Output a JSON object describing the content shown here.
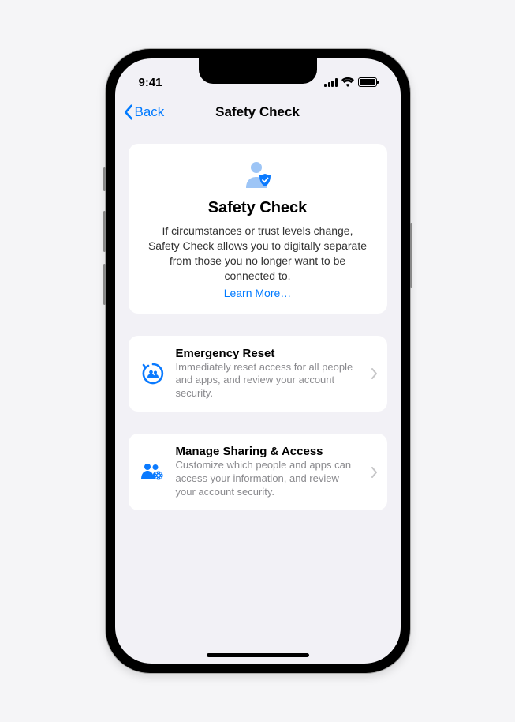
{
  "statusBar": {
    "time": "9:41"
  },
  "nav": {
    "back": "Back",
    "title": "Safety Check"
  },
  "hero": {
    "title": "Safety Check",
    "description": "If circumstances or trust levels change, Safety Check allows you to digitally separate from those you no longer want to be connected to.",
    "learnMore": "Learn More…"
  },
  "options": [
    {
      "title": "Emergency Reset",
      "description": "Immediately reset access for all people and apps, and review your account security."
    },
    {
      "title": "Manage Sharing & Access",
      "description": "Customize which people and apps can access your information, and review your account security."
    }
  ],
  "colors": {
    "accent": "#007aff",
    "iconLight": "#9dc5f6"
  }
}
